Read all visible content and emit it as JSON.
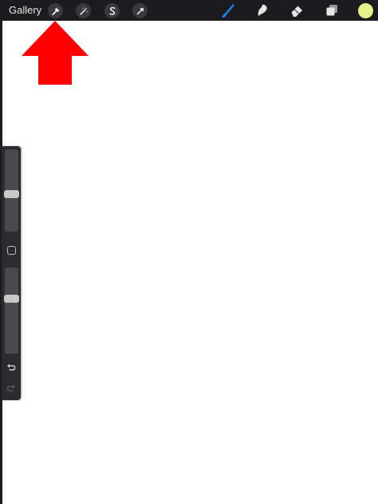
{
  "topbar": {
    "gallery_label": "Gallery",
    "left_tools": [
      {
        "name": "wrench-icon"
      },
      {
        "name": "magic-wand-icon"
      },
      {
        "name": "selection-icon"
      },
      {
        "name": "transform-arrow-icon"
      }
    ],
    "right_tools": [
      {
        "name": "brush-icon",
        "active": true
      },
      {
        "name": "smudge-icon"
      },
      {
        "name": "eraser-icon"
      },
      {
        "name": "layers-icon"
      }
    ],
    "current_color": "#e4f48a"
  },
  "colors": {
    "active_tool": "#1e88ff",
    "arrow": "#ff0000"
  },
  "sidebar": {
    "brush_size_level": 0.45,
    "opacity_level": 0.35,
    "modify_button_icon": "square-icon",
    "undo_icon": "undo-icon",
    "redo_icon": "redo-icon"
  }
}
